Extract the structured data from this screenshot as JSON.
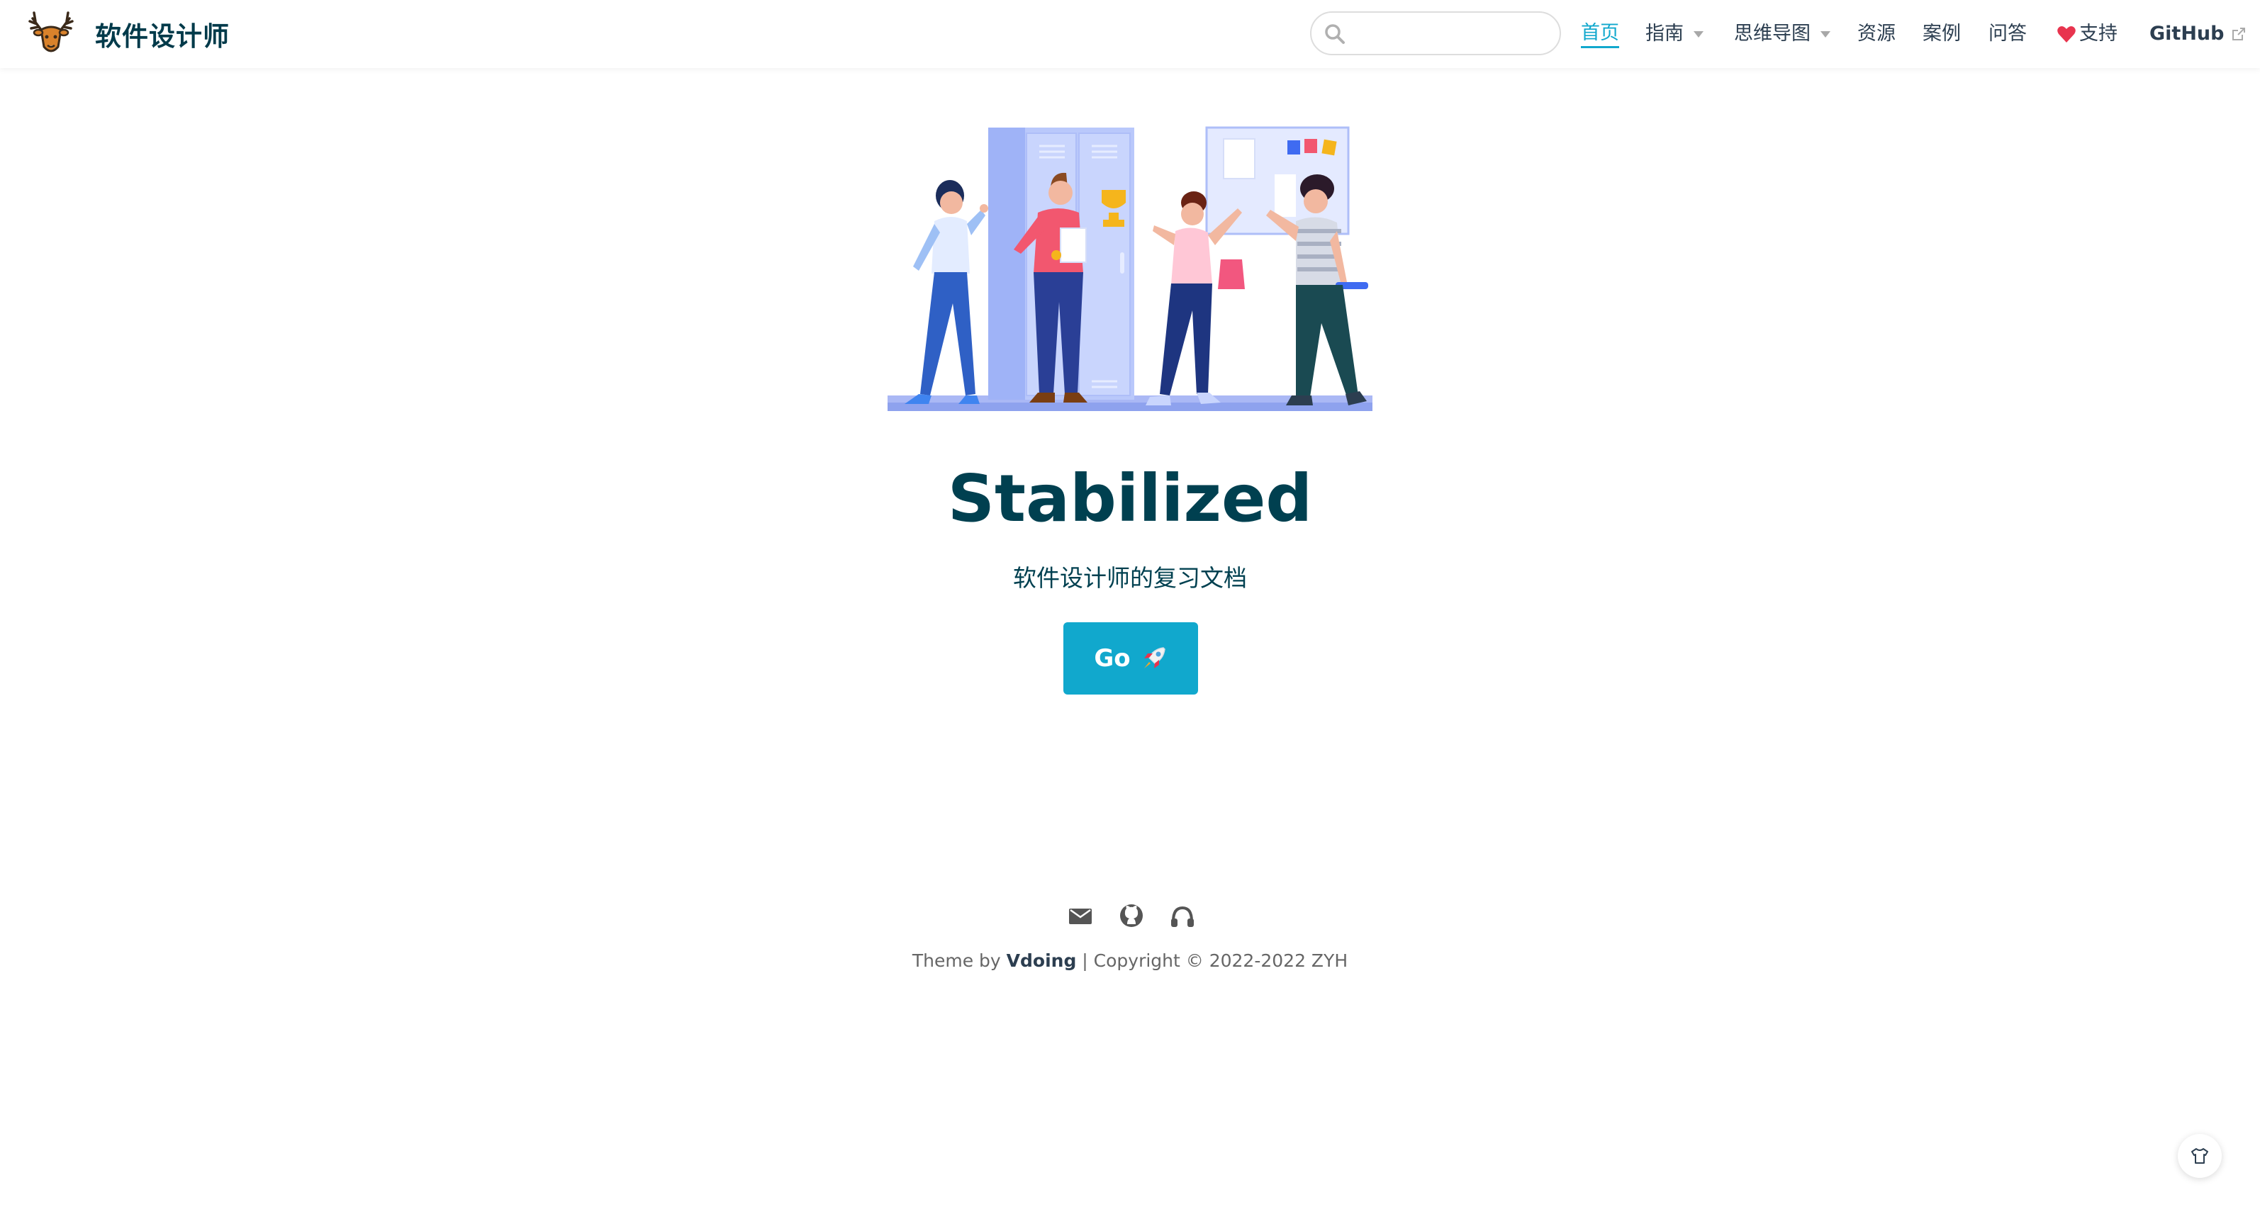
{
  "navbar": {
    "brand_title": "软件设计师",
    "search": {
      "value": "",
      "placeholder": ""
    },
    "items": [
      {
        "label": "首页",
        "active": true,
        "dropdown": false
      },
      {
        "label": "指南",
        "active": false,
        "dropdown": true
      },
      {
        "label": "思维导图",
        "active": false,
        "dropdown": true
      },
      {
        "label": "资源",
        "active": false,
        "dropdown": false
      },
      {
        "label": "案例",
        "active": false,
        "dropdown": false
      },
      {
        "label": "问答",
        "active": false,
        "dropdown": false
      },
      {
        "label": "支持",
        "active": false,
        "dropdown": false,
        "icon": "heart-icon"
      },
      {
        "label": "GitHub",
        "active": false,
        "dropdown": false,
        "icon": "external-link-icon"
      }
    ]
  },
  "hero": {
    "title": "Stabilized",
    "subtitle": "软件设计师的复习文档",
    "action_label": "Go",
    "action_icon": "rocket-icon"
  },
  "footer": {
    "icons": [
      "mail-icon",
      "github-icon",
      "headphones-icon"
    ],
    "theme_prefix": "Theme by",
    "theme_name": "Vdoing",
    "copyright": "| Copyright © 2022-2022 ZYH"
  },
  "floating_button": {
    "icon": "theme-shirt-icon"
  },
  "colors": {
    "accent": "#11a8cd",
    "title": "#004050",
    "nav_text": "#2c3e50"
  }
}
